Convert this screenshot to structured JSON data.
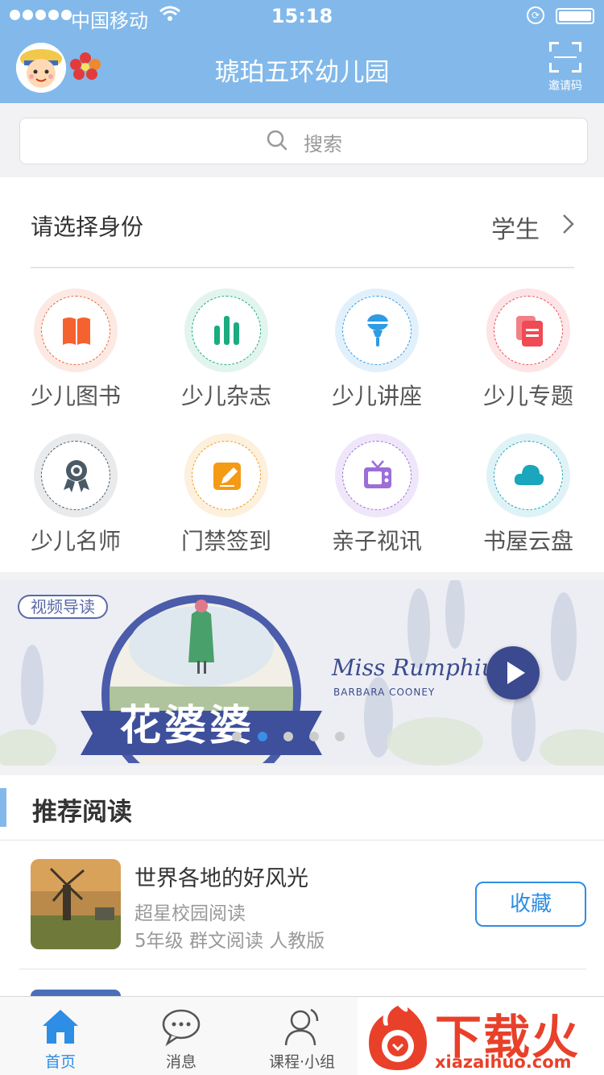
{
  "status_bar": {
    "carrier": "中国移动",
    "time": "15:18"
  },
  "header": {
    "school_name": "琥珀五环幼儿园",
    "scan_label": "邀请码",
    "icons": [
      "avatar",
      "flower-logo-icon",
      "scan-qr-icon"
    ]
  },
  "search": {
    "placeholder": "搜索"
  },
  "identity": {
    "label": "请选择身份",
    "value": "学生"
  },
  "grid": [
    {
      "label": "少儿图书",
      "icon": "book-icon",
      "color": "#f4622f"
    },
    {
      "label": "少儿杂志",
      "icon": "bar-chart-icon",
      "color": "#1aab7e"
    },
    {
      "label": "少儿讲座",
      "icon": "microphone-icon",
      "color": "#2e9be4"
    },
    {
      "label": "少儿专题",
      "icon": "documents-icon",
      "color": "#f04a54"
    },
    {
      "label": "少儿名师",
      "icon": "award-icon",
      "color": "#4a5a66"
    },
    {
      "label": "门禁签到",
      "icon": "edit-icon",
      "color": "#f59a14"
    },
    {
      "label": "亲子视讯",
      "icon": "tv-icon",
      "color": "#9c6ed8"
    },
    {
      "label": "书屋云盘",
      "icon": "cloud-icon",
      "color": "#1aa6bc"
    }
  ],
  "banner": {
    "tag": "视频导读",
    "cn_title": "花婆婆",
    "en_title": "Miss Rumphius",
    "en_author": "BARBARA COONEY",
    "pager_count": 5,
    "pager_active": 1
  },
  "recommend": {
    "title": "推荐阅读",
    "books": [
      {
        "name": "世界各地的好风光",
        "publisher": "超星校园阅读",
        "meta": "5年级 群文阅读 人教版",
        "action": "收藏"
      }
    ]
  },
  "tabbar": {
    "tabs": [
      {
        "label": "首页",
        "icon": "home-icon",
        "active": true
      },
      {
        "label": "消息",
        "icon": "chat-icon",
        "active": false
      },
      {
        "label": "课程·小组",
        "icon": "person-icon",
        "active": false
      }
    ]
  },
  "watermark": {
    "word": "下载火",
    "domain": "xiazaihuo.com"
  },
  "colors": {
    "header_bg": "#82b9ea",
    "accent": "#2e8de4"
  }
}
